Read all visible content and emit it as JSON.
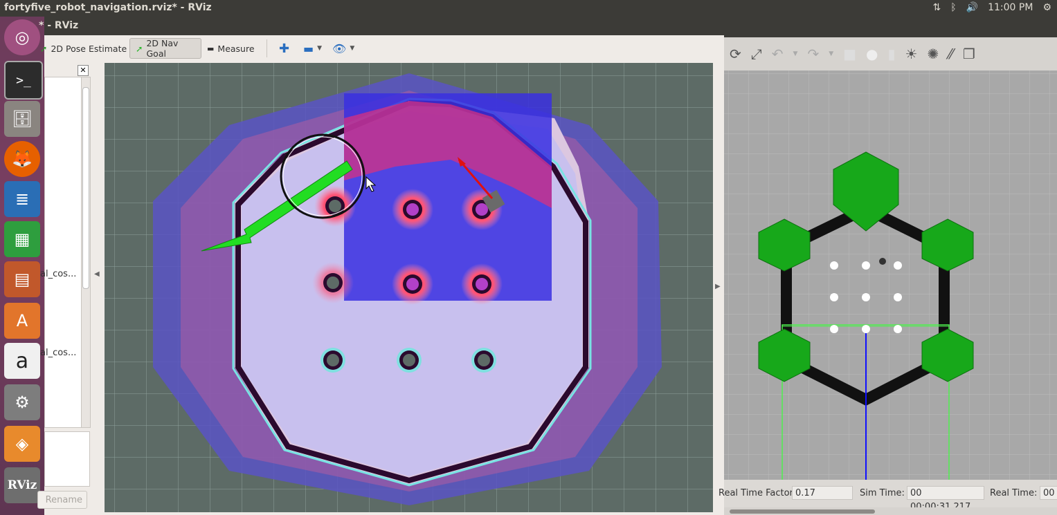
{
  "topbar": {
    "title": "fortyfive_robot_navigation.rviz* - RViz",
    "time": "11:00 PM",
    "icons": [
      "network-icon",
      "bluetooth-icon",
      "volume-icon",
      "settings-icon"
    ]
  },
  "launcher": {
    "items": [
      "ubuntu-home-icon",
      "terminal-icon",
      "files-icon",
      "firefox-icon",
      "writer-icon",
      "calc-icon",
      "impress-icon",
      "software-center-icon",
      "amazon-icon",
      "system-settings-icon",
      "gazebo-icon",
      "rviz-icon"
    ],
    "rviz_label": "RViz"
  },
  "rviz": {
    "window_title": "* - RViz",
    "toolbar": {
      "pose_estimate": "2D Pose Estimate",
      "nav_goal": "2D Nav Goal",
      "measure": "Measure"
    },
    "panel": {
      "item1": "al_cos...",
      "item2": "al_cos...",
      "rename": "Rename"
    }
  },
  "gazebo": {
    "status": {
      "rtf_label": "Real Time Factor:",
      "rtf_value": "0.17",
      "sim_label": "Sim Time:",
      "sim_value": "00 00:00:31.217",
      "real_label": "Real Time:",
      "real_value": "00"
    }
  },
  "colors": {
    "ubuntu_panel": "#3c3b37",
    "launcher": "#7a3f62",
    "costmap_blue": "#3a2fe0",
    "costmap_red": "#ff2244",
    "goal_arrow": "#22dd22",
    "hexagon_green": "#17a81a"
  }
}
